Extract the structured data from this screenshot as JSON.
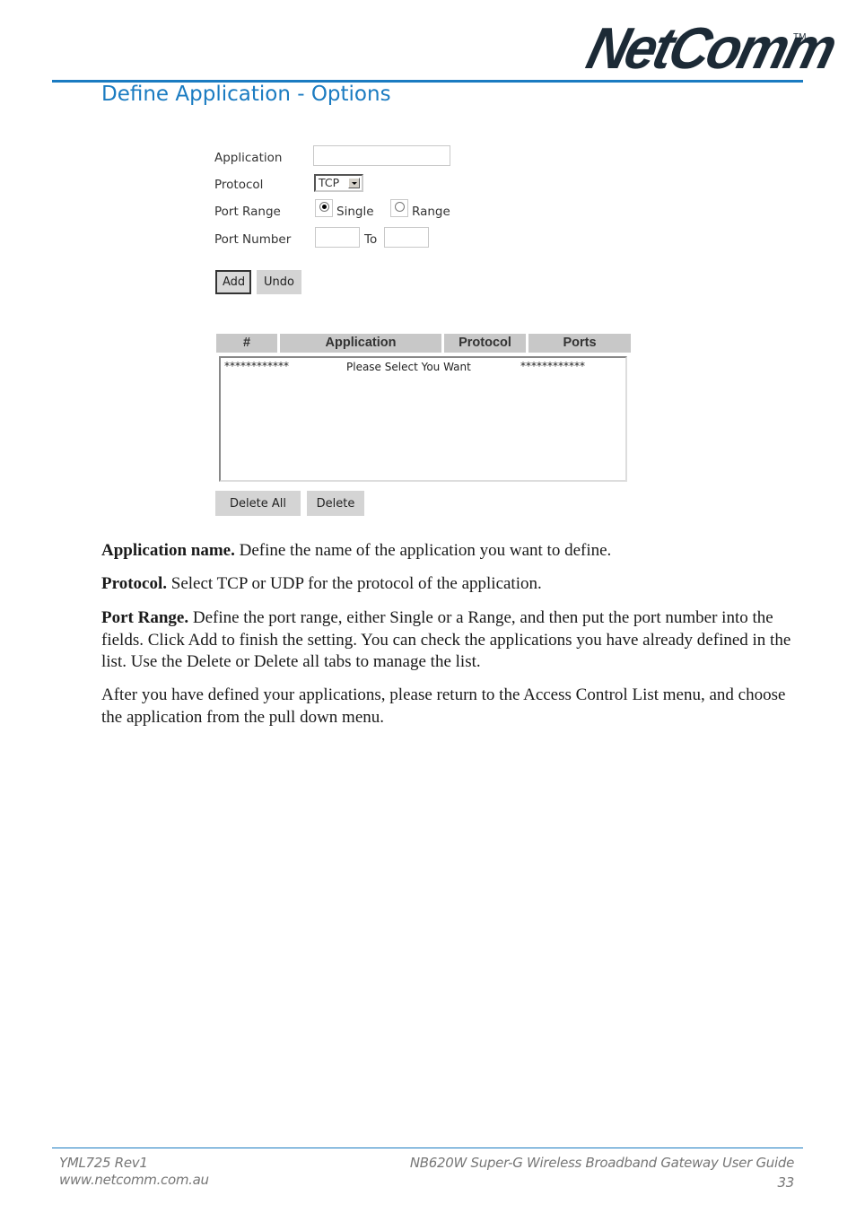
{
  "header": {
    "logo": "NetComm",
    "trademark": "TM",
    "section_title": "Define Application - Options"
  },
  "form": {
    "application_label": "Application",
    "application_value": "",
    "protocol_label": "Protocol",
    "protocol_selected": "TCP",
    "port_range_label": "Port Range",
    "port_range_options": [
      {
        "label": "Single",
        "selected": true
      },
      {
        "label": "Range",
        "selected": false
      }
    ],
    "port_number_label": "Port Number",
    "port_from_value": "",
    "to_label": "To",
    "port_to_value": "",
    "add_button": "Add",
    "undo_button": "Undo"
  },
  "table": {
    "columns": [
      "#",
      "Application",
      "Protocol",
      "Ports"
    ],
    "rows": [
      {
        "left": "************",
        "middle": "Please Select You Want",
        "right": "************"
      }
    ],
    "delete_all_button": "Delete All",
    "delete_button": "Delete"
  },
  "body": {
    "paragraphs": [
      {
        "term": "Application name.",
        "text": " Define the name of the application you want to define."
      },
      {
        "term": "Protocol.",
        "text": " Select TCP or UDP for the protocol of the application."
      },
      {
        "term": "Port Range.",
        "text": " Define the port range, either Single or a Range, and then put the port number into the fields. Click Add to finish the setting. You can check the applications you have already defined in the list. Use the Delete or Delete all tabs to manage the list."
      },
      {
        "term": "",
        "text": "After you have defined your applications, please return to the Access Control List menu, and choose the application from the pull down menu."
      }
    ]
  },
  "footer": {
    "doc_code": "YML725 Rev1",
    "website": "www.netcomm.com.au",
    "guide_title": "NB620W Super-G Wireless Broadband  Gateway User Guide",
    "page_number": "33"
  }
}
